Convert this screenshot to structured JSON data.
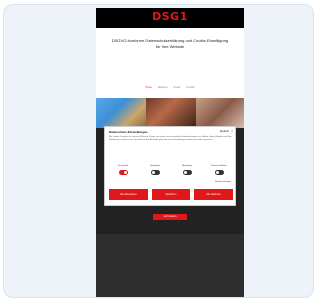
{
  "site": {
    "logo": "DSG1",
    "hero_text": "DSGVO-konforme Datenschutzerklärung und Cookie-Einwilligung für Ihre Website",
    "nav": [
      "Home",
      "Ratgeber",
      "Preise",
      "Kontakt"
    ]
  },
  "consent": {
    "title": "Datenschutz-Einstellungen",
    "language": "Deutsch",
    "body": "Wir nutzen Cookies auf unserer Website. Einige von ihnen sind essenziell, während andere uns helfen, diese Website und Ihre Erfahrung zu verbessern. Sie können Ihre Auswahl jederzeit unter Einstellungen widerrufen oder anpassen.",
    "toggles": [
      {
        "label": "Essenziell",
        "on": true
      },
      {
        "label": "Statistiken",
        "on": false
      },
      {
        "label": "Marketing",
        "on": false
      },
      {
        "label": "Externe Medien",
        "on": false
      }
    ],
    "details_link": "Details anzeigen",
    "buttons": {
      "accept_all": "Alle akzeptieren",
      "save": "Speichern",
      "decline": "Alle ablehnen"
    }
  },
  "cta_label": "Jetzt starten",
  "colors": {
    "brand_red": "#e0181a",
    "card_bg": "#eef3fa"
  }
}
